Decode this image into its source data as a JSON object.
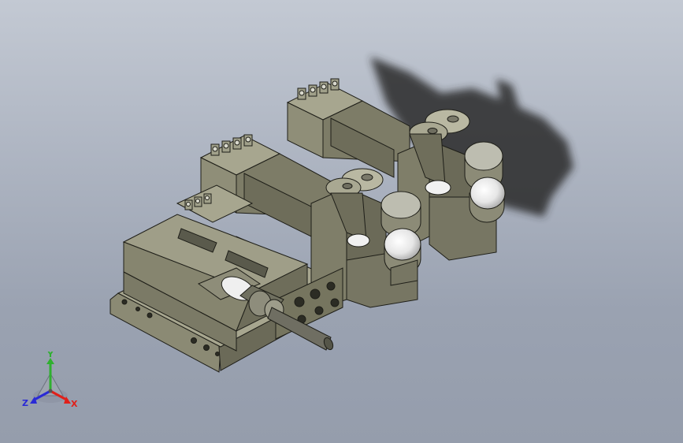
{
  "viewport": {
    "background_top": "#c3c9d3",
    "background_bottom": "#959dac"
  },
  "model": {
    "body_color": "#85846f",
    "shadow_color": "#2a2a2c",
    "cap_color": "#e4e4e4"
  },
  "triad": {
    "x_label": "X",
    "y_label": "Y",
    "z_label": "Z",
    "x_color": "#e0201a",
    "y_color": "#2fb02f",
    "z_color": "#2a2ad6"
  }
}
